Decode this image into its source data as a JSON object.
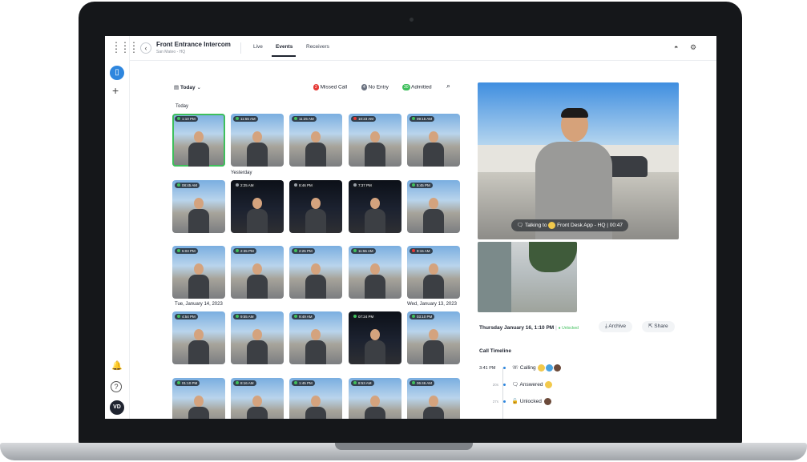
{
  "header": {
    "title": "Front Entrance Intercom",
    "subtitle": "San Mateo - HQ",
    "tabs": [
      {
        "label": "Live",
        "active": false
      },
      {
        "label": "Events",
        "active": true
      },
      {
        "label": "Receivers",
        "active": false
      }
    ]
  },
  "sidebar": {
    "avatar_initials": "VD"
  },
  "filters": {
    "date_label": "Today",
    "missed": {
      "label": "Missed Call",
      "count": "2",
      "color": "#e53935"
    },
    "noentry": {
      "label": "No Entry",
      "count": "4",
      "color": "#6b7280"
    },
    "admitted": {
      "label": "Admitted",
      "count": "30",
      "color": "#3fbf5c"
    }
  },
  "sections": {
    "today": "Today",
    "yesterday": "Yesterday",
    "tue": "Tue, January 14, 2023",
    "wed": "Wed, January 13, 2023"
  },
  "events": [
    {
      "time": "1:10 PM",
      "status": "admitted"
    },
    {
      "time": "11:55 AM",
      "status": "admitted"
    },
    {
      "time": "11:25 AM",
      "status": "admitted"
    },
    {
      "time": "10:23 AM",
      "status": "missed"
    },
    {
      "time": "09:15 AM",
      "status": "admitted"
    },
    {
      "time": "08:45 AM",
      "status": "admitted"
    },
    {
      "time": "2:25 AM",
      "status": "noentry"
    },
    {
      "time": "8:46 PM",
      "status": "noentry"
    },
    {
      "time": "7:37 PM",
      "status": "noentry"
    },
    {
      "time": "5:45 PM",
      "status": "admitted"
    },
    {
      "time": "5:03 PM",
      "status": "admitted"
    },
    {
      "time": "2:35 PM",
      "status": "admitted"
    },
    {
      "time": "2:25 PM",
      "status": "admitted"
    },
    {
      "time": "11:55 AM",
      "status": "admitted"
    },
    {
      "time": "9:15 AM",
      "status": "missed"
    },
    {
      "time": "4:54 PM",
      "status": "admitted"
    },
    {
      "time": "9:55 AM",
      "status": "admitted"
    },
    {
      "time": "9:49 AM",
      "status": "admitted"
    },
    {
      "time": "07:24 PM",
      "status": "admitted"
    },
    {
      "time": "03:10 PM",
      "status": "admitted"
    },
    {
      "time": "01:10 PM",
      "status": "admitted"
    },
    {
      "time": "8:16 AM",
      "status": "admitted"
    },
    {
      "time": "1:45 PM",
      "status": "admitted"
    },
    {
      "time": "8:53 AM",
      "status": "admitted"
    },
    {
      "time": "06:46 AM",
      "status": "admitted"
    }
  ],
  "detail": {
    "talking_prefix": "Talking to",
    "talking_target": "Front Desk App - HQ",
    "talking_duration": "00:47",
    "timestamp": "Thursday January 16, 1:10 PM",
    "status": "Unlocked",
    "archive_label": "Archive",
    "share_label": "Share",
    "timeline_title": "Call Timeline",
    "timeline": [
      {
        "time": "3:41 PM",
        "label": "Calling"
      },
      {
        "time": "20s",
        "label": "Answered"
      },
      {
        "time": "27s",
        "label": "Unlocked"
      }
    ]
  }
}
